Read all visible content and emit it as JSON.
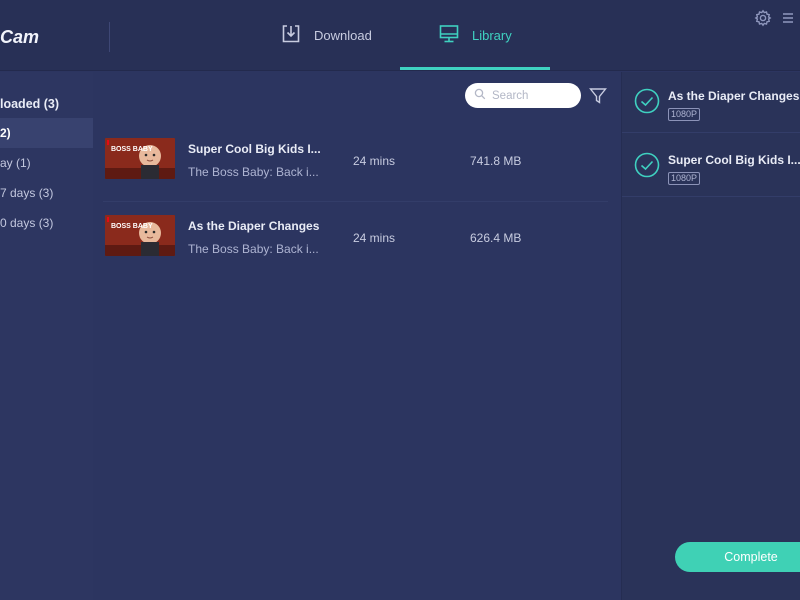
{
  "app": {
    "brand": "Cam"
  },
  "tabs": {
    "download": {
      "label": "Download"
    },
    "library": {
      "label": "Library",
      "active": true
    }
  },
  "colors": {
    "accent": "#3fd1c0",
    "background": "#2c3560",
    "complete_button": "#3fd1b5"
  },
  "sidebar": {
    "items": [
      {
        "label": "loaded (3)"
      },
      {
        "label": "2)"
      },
      {
        "label": "ay (1)"
      },
      {
        "label": "7 days (3)"
      },
      {
        "label": "0 days (3)"
      }
    ]
  },
  "library": {
    "search_placeholder": "Search",
    "rows": [
      {
        "title": "Super Cool Big Kids I...",
        "subtitle": "The Boss Baby: Back i...",
        "duration": "24 mins",
        "size": "741.8 MB",
        "thumb_text": "BOSS BABY"
      },
      {
        "title": "As the Diaper Changes",
        "subtitle": "The Boss Baby: Back i...",
        "duration": "24 mins",
        "size": "626.4 MB",
        "thumb_text": "BOSS BABY"
      }
    ]
  },
  "queue": {
    "items": [
      {
        "title": "As the Diaper Changes",
        "quality": "1080P"
      },
      {
        "title": "Super Cool Big Kids I...",
        "quality": "1080P"
      }
    ],
    "complete_label": "Complete"
  },
  "icons": {
    "download_tab": "download-tray-icon",
    "library_tab": "monitor-icon",
    "settings": "gear-icon",
    "menu": "hamburger-menu-icon",
    "search": "search-icon",
    "filter": "filter-funnel-icon",
    "done": "check-circle-icon"
  }
}
